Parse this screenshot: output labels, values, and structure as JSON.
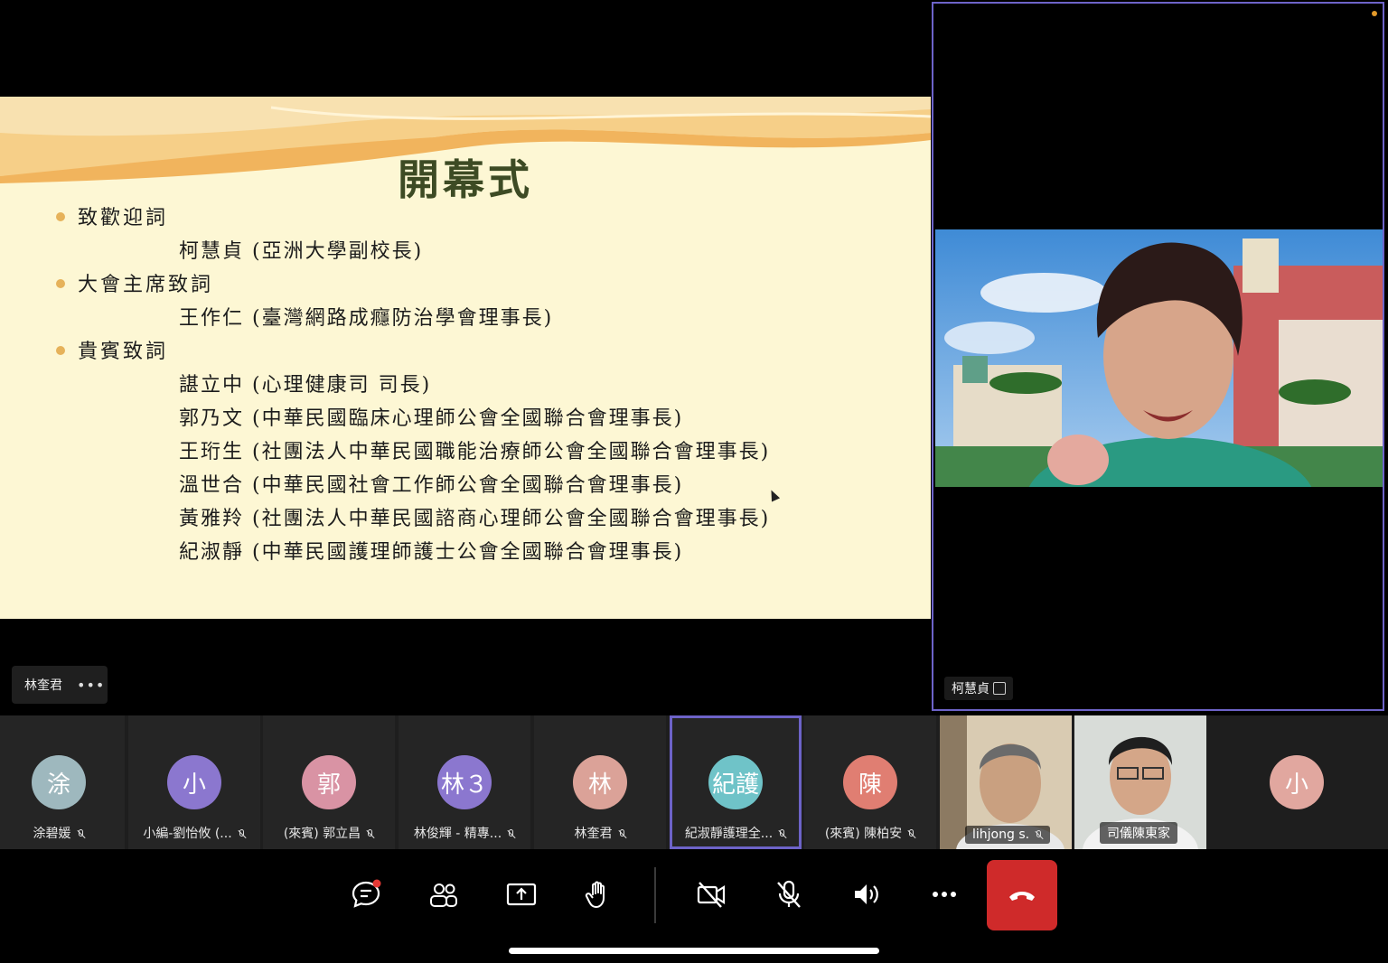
{
  "slide": {
    "title": "開幕式",
    "sections": [
      {
        "heading": "致歡迎詞",
        "items": [
          "柯慧貞 (亞洲大學副校長)"
        ]
      },
      {
        "heading": "大會主席致詞",
        "items": [
          "王作仁 (臺灣網路成癮防治學會理事長)"
        ]
      },
      {
        "heading": "貴賓致詞",
        "items": [
          "諶立中 (心理健康司 司長)",
          "郭乃文 (中華民國臨床心理師公會全國聯合會理事長)",
          "王珩生 (社團法人中華民國職能治療師公會全國聯合會理事長)",
          "溫世合 (中華民國社會工作師公會全國聯合會理事長)",
          "黃雅羚 (社團法人中華民國諮商心理師公會全國聯合會理事長)",
          "紀淑靜 (中華民國護理師護士公會全國聯合會理事長)"
        ]
      }
    ]
  },
  "presenter_tag": {
    "name": "林奎君",
    "more": "•••"
  },
  "speaker": {
    "name": "柯慧貞"
  },
  "participants": [
    {
      "initial": "涂",
      "name": "涂碧媛",
      "color": "#9eb8be"
    },
    {
      "initial": "小",
      "name": "小編-劉怡攸 (...",
      "color": "#8b77cf"
    },
    {
      "initial": "郭",
      "name": "(來賓) 郭立昌",
      "color": "#d993a4"
    },
    {
      "initial": "林３",
      "name": "林俊輝 - 精專...",
      "color": "#8b77cf"
    },
    {
      "initial": "林",
      "name": "林奎君",
      "color": "#dba298"
    },
    {
      "initial": "紀護",
      "name": "紀淑靜護理全...",
      "color": "#6fc3c8"
    },
    {
      "initial": "陳",
      "name": "(來賓) 陳柏安",
      "color": "#e07e72"
    },
    {
      "name": "lihjong s."
    },
    {
      "name": "司儀陳東家"
    },
    {
      "initial": "小",
      "color": "#e1a79f"
    }
  ],
  "toolbar": {
    "icons": [
      "chat-icon",
      "participants-icon",
      "share-icon",
      "raise-hand-icon",
      "camera-off-icon",
      "mic-off-icon",
      "speaker-icon",
      "more-icon",
      "end-call-icon"
    ],
    "colors": {
      "end_call": "#cf2a2a",
      "active_border": "#6d63c8",
      "notification": "#e53935"
    }
  }
}
